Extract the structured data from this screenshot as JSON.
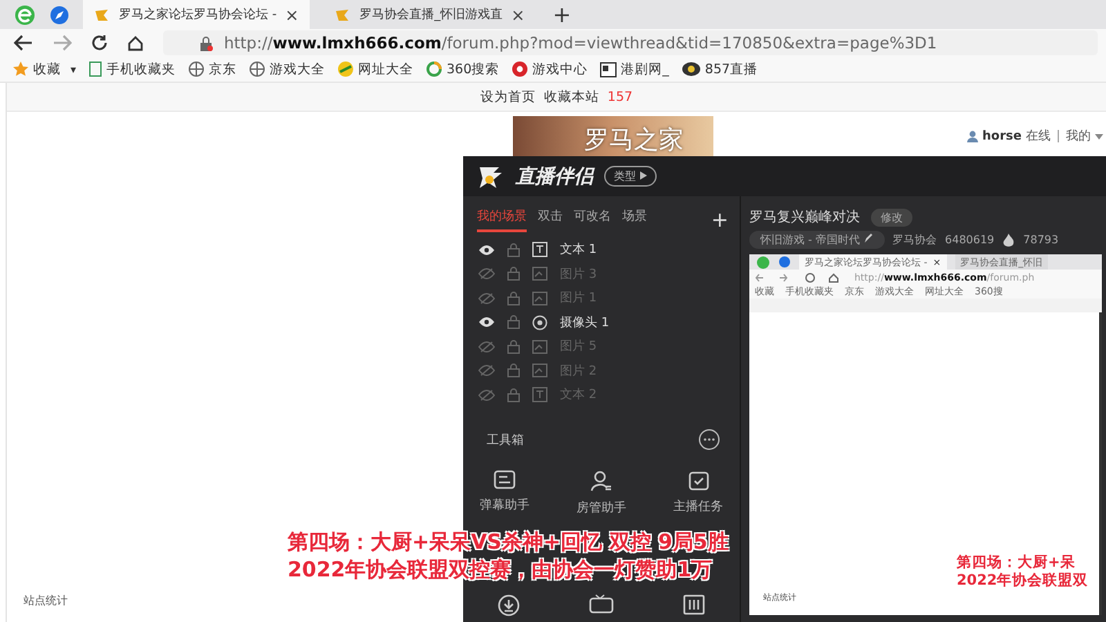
{
  "browser": {
    "tabs": [
      {
        "title": "罗马之家论坛罗马协会论坛 - ",
        "selected": true,
        "close": "×"
      },
      {
        "title": "罗马协会直播_怀旧游戏直",
        "selected": false,
        "close": "×"
      }
    ],
    "new_tab": "+",
    "url": "http://**www.lmxh666.com**/forum.php?mod=viewthread&tid=170850&extra=page%3D1",
    "bookmarks": [
      {
        "label": "收藏",
        "kind": "star",
        "caret": "▾"
      },
      {
        "label": "手机收藏夹",
        "kind": "phone"
      },
      {
        "label": "京东",
        "kind": "globe"
      },
      {
        "label": "游戏大全",
        "kind": "globe"
      },
      {
        "label": "网址大全",
        "kind": "ball"
      },
      {
        "label": "360搜索",
        "kind": "ring"
      },
      {
        "label": "游戏中心",
        "kind": "game"
      },
      {
        "label": "港剧网_",
        "kind": "news"
      },
      {
        "label": "857直播",
        "kind": "eye"
      }
    ]
  },
  "page": {
    "top_links": [
      "设为首页",
      "收藏本站"
    ],
    "count": "157",
    "banner": "罗马之家",
    "user": "horse",
    "status": "在线",
    "menu": "我的",
    "footer": "站点统计"
  },
  "streamer": {
    "app_name": "直播伴侣",
    "type_button": "类型",
    "scene_tabs": [
      {
        "label": "我的场景",
        "selected": true
      },
      {
        "label": "双击",
        "selected": false
      },
      {
        "label": "可改名",
        "selected": false
      },
      {
        "label": "场景",
        "selected": false
      }
    ],
    "add": "+",
    "sources": [
      {
        "name": "文本 1",
        "kind": "text",
        "visible": true
      },
      {
        "name": "图片 3",
        "kind": "image",
        "visible": false
      },
      {
        "name": "图片 1",
        "kind": "image",
        "visible": false
      },
      {
        "name": "摄像头 1",
        "kind": "camera",
        "visible": true
      },
      {
        "name": "图片 5",
        "kind": "image",
        "visible": false
      },
      {
        "name": "图片 2",
        "kind": "image",
        "visible": false
      },
      {
        "name": "文本 2",
        "kind": "text",
        "visible": false
      }
    ],
    "toolbox": "工具箱",
    "tools": [
      {
        "label": "弹幕助手",
        "kind": "chat"
      },
      {
        "label": "房管助手",
        "kind": "user"
      },
      {
        "label": "主播任务",
        "kind": "task"
      }
    ],
    "stream_title": "罗马复兴巅峰对决",
    "edit_button": "修改",
    "category": "怀旧游戏 - 帝国时代",
    "channel": "罗马协会",
    "room_id": "6480619",
    "popularity": "78793",
    "preview": {
      "tabs": [
        {
          "title": "罗马之家论坛罗马协会论坛 - ",
          "selected": true,
          "close": "×"
        },
        {
          "title": "罗马协会直播_怀旧",
          "selected": false
        }
      ],
      "url": "http://**www.lmxh666.com**/forum.ph",
      "bookmarks": [
        "收藏",
        "手机收藏夹",
        "京东",
        "游戏大全",
        "网址大全",
        "360搜"
      ],
      "footer": "站点统计",
      "caption": [
        "第四场：大厨+呆",
        "2022年协会联盟双"
      ]
    }
  },
  "caption": [
    "第四场：大厨+呆呆VS杀神+回忆 双控 9局5胜",
    "2022年协会联盟双控赛，由协会一灯赞助1万"
  ]
}
